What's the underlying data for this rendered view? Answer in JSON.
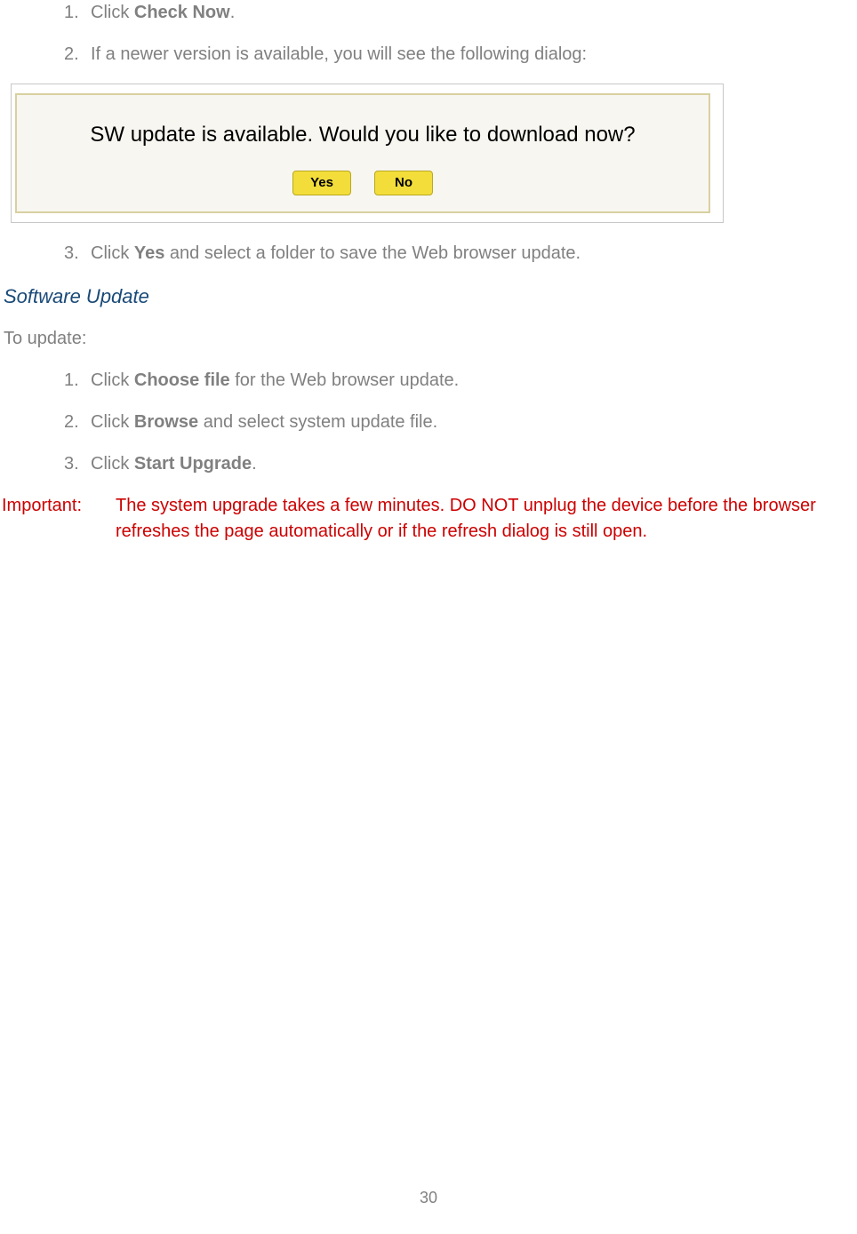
{
  "list1": {
    "items": [
      {
        "num": "1.",
        "pre": "Click ",
        "bold": "Check Now",
        "post": "."
      },
      {
        "num": "2.",
        "pre": "If a newer version is available, you will see the following dialog:",
        "bold": "",
        "post": ""
      }
    ]
  },
  "dialog": {
    "message": "SW update is available. Would you like to download now?",
    "yes": "Yes",
    "no": "No"
  },
  "list1b": {
    "items": [
      {
        "num": "3.",
        "pre": "Click ",
        "bold": "Yes",
        "post": " and select a folder to save the Web browser update."
      }
    ]
  },
  "heading2": "Software Update",
  "para1": "To update:",
  "list2": {
    "items": [
      {
        "num": "1.",
        "pre": "Click ",
        "bold": "Choose file",
        "post": " for the Web browser update."
      },
      {
        "num": "2.",
        "pre": "Click ",
        "bold": "Browse",
        "post": " and select system update file."
      },
      {
        "num": "3.",
        "pre": "Click ",
        "bold": "Start Upgrade",
        "post": "."
      }
    ]
  },
  "important": {
    "label": "Important:",
    "body": "The system upgrade takes a few minutes. DO NOT unplug the device before the browser refreshes the page automatically or if the refresh dialog is still open."
  },
  "page_number": "30"
}
